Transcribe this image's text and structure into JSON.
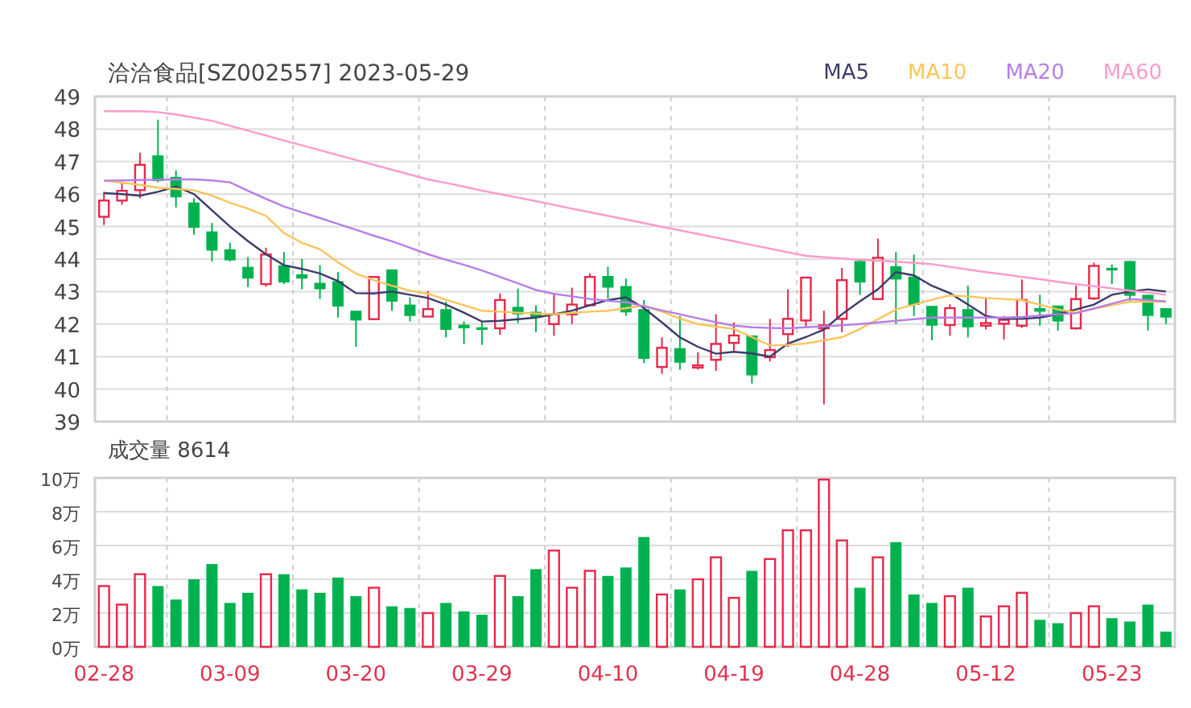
{
  "title": "洽洽食品[SZ002557] 2023-05-29",
  "price_chart": {
    "chart_data": {
      "type": "candlestick",
      "grid": true,
      "ylim": [
        39,
        49
      ],
      "yticks": [
        39,
        40,
        41,
        42,
        43,
        44,
        45,
        46,
        47,
        48,
        49
      ],
      "series": [
        {
          "name": "MA5",
          "color": "#3d3b6b",
          "type": "line",
          "values": [
            46.03,
            46.0,
            45.95,
            46.07,
            46.23,
            46.0,
            45.5,
            45.0,
            44.55,
            44.15,
            43.81,
            43.7,
            43.56,
            43.32,
            42.95,
            42.94,
            43.0,
            42.9,
            42.8,
            42.6,
            42.35,
            42.08,
            42.1,
            42.15,
            42.2,
            42.3,
            42.41,
            42.58,
            42.74,
            42.82,
            42.49,
            42.05,
            41.59,
            41.3,
            41.09,
            41.15,
            41.1,
            41.0,
            41.4,
            41.6,
            41.83,
            42.3,
            42.7,
            43.07,
            43.6,
            43.5,
            43.18,
            42.95,
            42.6,
            42.25,
            42.16,
            42.16,
            42.2,
            42.3,
            42.45,
            42.6,
            42.9,
            43.0,
            43.07,
            43.0
          ]
        },
        {
          "name": "MA10",
          "color": "#fbc55a",
          "type": "line",
          "values": [
            46.41,
            46.35,
            46.28,
            46.2,
            46.16,
            46.12,
            45.95,
            45.74,
            45.55,
            45.33,
            44.8,
            44.5,
            44.3,
            43.9,
            43.55,
            43.35,
            43.18,
            43.03,
            42.93,
            42.75,
            42.58,
            42.41,
            42.38,
            42.35,
            42.32,
            42.3,
            42.34,
            42.38,
            42.41,
            42.49,
            42.57,
            42.38,
            42.17,
            42.0,
            41.92,
            41.85,
            41.6,
            41.34,
            41.36,
            41.4,
            41.5,
            41.6,
            41.85,
            42.15,
            42.45,
            42.6,
            42.75,
            42.88,
            42.85,
            42.8,
            42.77,
            42.74,
            42.6,
            42.45,
            42.36,
            42.47,
            42.58,
            42.69,
            42.69,
            42.69
          ]
        },
        {
          "name": "MA20",
          "color": "#b77ee6",
          "type": "line",
          "values": [
            46.41,
            46.42,
            46.43,
            46.44,
            46.45,
            46.45,
            46.42,
            46.36,
            46.1,
            45.85,
            45.62,
            45.44,
            45.26,
            45.08,
            44.9,
            44.72,
            44.55,
            44.35,
            44.15,
            43.98,
            43.82,
            43.65,
            43.45,
            43.25,
            43.05,
            42.93,
            42.85,
            42.77,
            42.72,
            42.67,
            42.55,
            42.42,
            42.3,
            42.18,
            42.06,
            41.95,
            41.9,
            41.88,
            41.87,
            41.9,
            41.93,
            41.96,
            42.0,
            42.05,
            42.1,
            42.15,
            42.2,
            42.2,
            42.2,
            42.2,
            42.2,
            42.22,
            42.26,
            42.3,
            42.33,
            42.48,
            42.63,
            42.77,
            42.74,
            42.7
          ]
        },
        {
          "name": "MA60",
          "color": "#fb9bcc",
          "type": "line",
          "values": [
            48.55,
            48.55,
            48.55,
            48.52,
            48.45,
            48.35,
            48.25,
            48.1,
            47.95,
            47.8,
            47.65,
            47.5,
            47.35,
            47.2,
            47.05,
            46.9,
            46.75,
            46.6,
            46.45,
            46.34,
            46.23,
            46.11,
            46.0,
            45.89,
            45.78,
            45.67,
            45.55,
            45.44,
            45.33,
            45.22,
            45.11,
            44.99,
            44.88,
            44.77,
            44.66,
            44.55,
            44.43,
            44.32,
            44.21,
            44.1,
            44.06,
            44.02,
            43.98,
            43.95,
            43.92,
            43.88,
            43.84,
            43.76,
            43.68,
            43.6,
            43.53,
            43.45,
            43.38,
            43.3,
            43.23,
            43.17,
            43.1,
            43.03,
            42.97,
            42.9
          ]
        }
      ],
      "ohlc": [
        [
          45.3,
          46.07,
          45.05,
          45.8
        ],
        [
          45.8,
          46.33,
          45.67,
          46.1
        ],
        [
          46.12,
          47.27,
          45.87,
          46.9
        ],
        [
          47.19,
          48.29,
          46.36,
          46.4
        ],
        [
          46.53,
          46.73,
          45.59,
          45.9
        ],
        [
          45.74,
          45.87,
          44.75,
          44.96
        ],
        [
          44.85,
          45.11,
          43.93,
          44.26
        ],
        [
          44.3,
          44.5,
          43.93,
          43.96
        ],
        [
          43.76,
          44.06,
          43.14,
          43.4
        ],
        [
          43.23,
          44.35,
          43.15,
          44.14
        ],
        [
          43.81,
          44.22,
          43.23,
          43.28
        ],
        [
          43.53,
          44.0,
          43.07,
          43.4
        ],
        [
          43.27,
          43.81,
          42.77,
          43.07
        ],
        [
          43.32,
          43.6,
          42.2,
          42.54
        ],
        [
          42.41,
          42.41,
          41.3,
          42.11
        ],
        [
          42.15,
          43.45,
          42.15,
          43.45
        ],
        [
          43.68,
          43.68,
          42.41,
          42.69
        ],
        [
          42.6,
          42.82,
          42.08,
          42.25
        ],
        [
          42.23,
          43.02,
          42.23,
          42.46
        ],
        [
          42.46,
          42.69,
          41.59,
          41.82
        ],
        [
          41.98,
          42.08,
          41.39,
          41.87
        ],
        [
          41.9,
          42.08,
          41.36,
          41.82
        ],
        [
          41.87,
          42.94,
          41.67,
          42.74
        ],
        [
          42.53,
          43.09,
          42.03,
          42.3
        ],
        [
          42.38,
          42.57,
          41.75,
          42.2
        ],
        [
          42.0,
          42.95,
          41.64,
          42.3
        ],
        [
          42.3,
          43.12,
          42.0,
          42.6
        ],
        [
          42.58,
          43.56,
          42.58,
          43.45
        ],
        [
          43.48,
          43.76,
          42.79,
          43.12
        ],
        [
          43.17,
          43.4,
          42.25,
          42.36
        ],
        [
          42.46,
          42.74,
          40.8,
          40.93
        ],
        [
          40.68,
          41.59,
          40.47,
          41.27
        ],
        [
          41.26,
          42.25,
          40.6,
          40.81
        ],
        [
          40.66,
          41.13,
          40.6,
          40.73
        ],
        [
          40.9,
          42.3,
          40.56,
          41.39
        ],
        [
          41.42,
          42.05,
          41.17,
          41.65
        ],
        [
          41.65,
          41.65,
          40.17,
          40.42
        ],
        [
          40.98,
          42.16,
          40.85,
          41.2
        ],
        [
          41.69,
          43.07,
          41.3,
          42.16
        ],
        [
          42.11,
          43.43,
          41.92,
          43.43
        ],
        [
          41.87,
          42.41,
          39.53,
          41.96
        ],
        [
          42.16,
          43.73,
          41.75,
          43.35
        ],
        [
          43.94,
          44.0,
          42.9,
          43.28
        ],
        [
          42.77,
          44.63,
          42.77,
          44.04
        ],
        [
          43.78,
          44.22,
          42.0,
          43.37
        ],
        [
          43.46,
          44.14,
          42.25,
          42.59
        ],
        [
          42.56,
          42.56,
          41.5,
          41.95
        ],
        [
          41.97,
          42.61,
          41.64,
          42.49
        ],
        [
          42.46,
          43.18,
          41.59,
          41.9
        ],
        [
          41.95,
          42.82,
          41.83,
          42.03
        ],
        [
          42.01,
          42.25,
          41.52,
          42.13
        ],
        [
          41.95,
          43.37,
          41.88,
          42.74
        ],
        [
          42.49,
          42.9,
          41.95,
          42.38
        ],
        [
          42.57,
          42.57,
          41.8,
          42.08
        ],
        [
          41.87,
          43.18,
          41.83,
          42.77
        ],
        [
          42.79,
          43.89,
          42.74,
          43.79
        ],
        [
          43.73,
          43.84,
          43.23,
          43.65
        ],
        [
          43.94,
          43.94,
          42.7,
          42.87
        ],
        [
          42.9,
          42.9,
          41.8,
          42.25
        ],
        [
          42.49,
          42.49,
          42.0,
          42.2
        ]
      ]
    }
  },
  "volume_chart": {
    "title": "成交量 8614",
    "chart_data": {
      "type": "bar",
      "grid": true,
      "ylim": [
        0,
        10
      ],
      "yticks": [
        {
          "value": 0,
          "label": "0万"
        },
        {
          "value": 2,
          "label": "2万"
        },
        {
          "value": 4,
          "label": "4万"
        },
        {
          "value": 6,
          "label": "6万"
        },
        {
          "value": 8,
          "label": "8万"
        },
        {
          "value": 10,
          "label": "10万"
        }
      ],
      "categories": [
        "02-28",
        null,
        null,
        null,
        null,
        null,
        null,
        "03-09",
        null,
        null,
        null,
        null,
        null,
        null,
        "03-20",
        null,
        null,
        null,
        null,
        null,
        null,
        "03-29",
        null,
        null,
        null,
        null,
        null,
        null,
        "04-10",
        null,
        null,
        null,
        null,
        null,
        null,
        "04-19",
        null,
        null,
        null,
        null,
        null,
        null,
        "04-28",
        null,
        null,
        null,
        null,
        null,
        null,
        "05-12",
        null,
        null,
        null,
        null,
        null,
        null,
        "05-23",
        null,
        null,
        null
      ],
      "values": [
        3.6,
        2.5,
        4.3,
        3.6,
        2.8,
        4.0,
        4.9,
        2.6,
        3.2,
        4.3,
        4.3,
        3.4,
        3.2,
        4.1,
        3.0,
        3.5,
        2.4,
        2.3,
        2.0,
        2.6,
        2.1,
        1.9,
        4.2,
        3.0,
        4.6,
        5.7,
        3.5,
        4.5,
        4.2,
        4.7,
        6.5,
        3.1,
        3.4,
        4.0,
        5.3,
        2.9,
        4.5,
        5.2,
        6.9,
        6.9,
        9.9,
        6.3,
        3.5,
        5.3,
        6.2,
        3.1,
        2.6,
        3.0,
        3.5,
        1.8,
        2.4,
        3.2,
        1.6,
        1.4,
        2.0,
        2.4,
        1.7,
        1.5,
        2.5,
        0.9
      ]
    }
  }
}
